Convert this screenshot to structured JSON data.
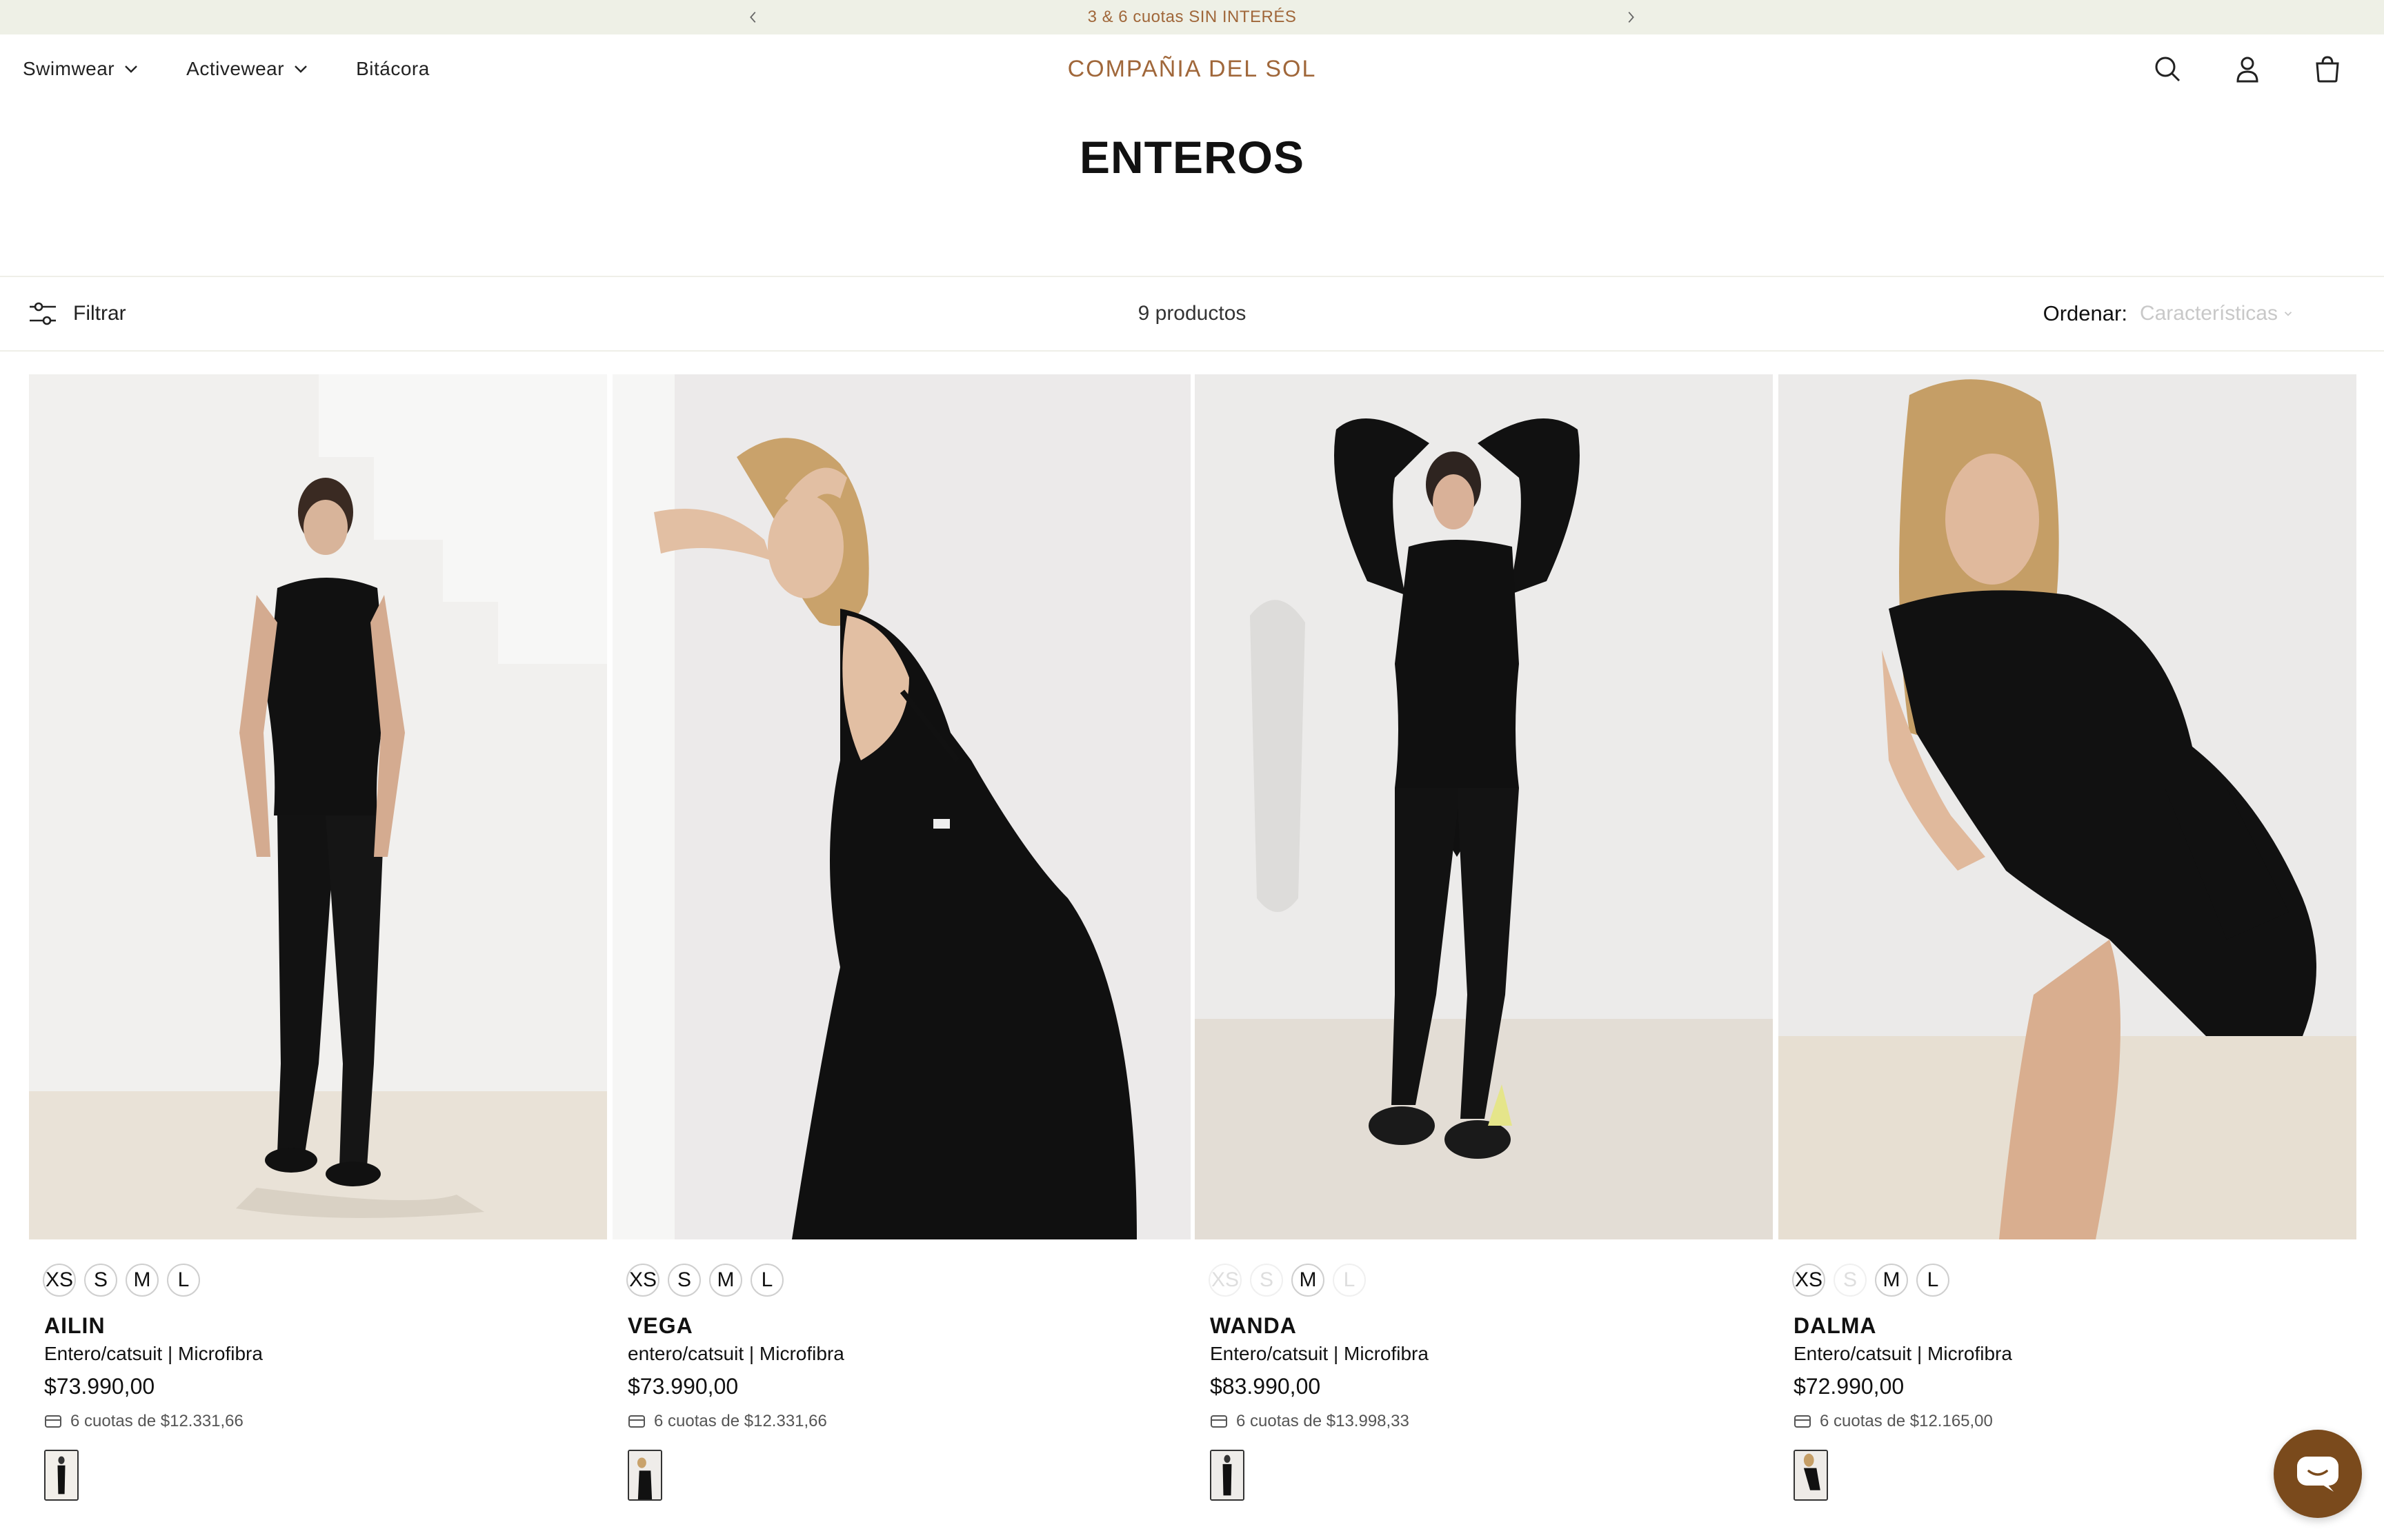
{
  "announcement": {
    "message": "3 & 6 cuotas SIN INTERÉS",
    "prev_icon": "chevron-left-icon",
    "next_icon": "chevron-right-icon"
  },
  "header": {
    "logo": "COMPAÑIA DEL SOL",
    "nav": [
      {
        "label": "Swimwear",
        "has_dropdown": true
      },
      {
        "label": "Activewear",
        "has_dropdown": true
      },
      {
        "label": "Bitácora",
        "has_dropdown": false
      }
    ],
    "icons": [
      "search-icon",
      "account-icon",
      "bag-icon"
    ]
  },
  "page": {
    "title": "ENTEROS"
  },
  "toolbar": {
    "filter_label": "Filtrar",
    "product_count": "9 productos",
    "sort_label": "Ordenar:",
    "sort_value": "Características"
  },
  "products": [
    {
      "name": "AILIN",
      "description": "Entero/catsuit | Microfibra",
      "price": "$73.990,00",
      "installments": "6 cuotas de $12.331,66",
      "sizes": [
        {
          "label": "XS",
          "available": true
        },
        {
          "label": "S",
          "available": true
        },
        {
          "label": "M",
          "available": true
        },
        {
          "label": "L",
          "available": true
        }
      ]
    },
    {
      "name": "VEGA",
      "description": "entero/catsuit | Microfibra",
      "price": "$73.990,00",
      "installments": "6 cuotas de $12.331,66",
      "sizes": [
        {
          "label": "XS",
          "available": true
        },
        {
          "label": "S",
          "available": true
        },
        {
          "label": "M",
          "available": true
        },
        {
          "label": "L",
          "available": true
        }
      ]
    },
    {
      "name": "WANDA",
      "description": "Entero/catsuit | Microfibra",
      "price": "$83.990,00",
      "installments": "6 cuotas de $13.998,33",
      "sizes": [
        {
          "label": "XS",
          "available": false
        },
        {
          "label": "S",
          "available": false
        },
        {
          "label": "M",
          "available": true
        },
        {
          "label": "L",
          "available": false
        }
      ]
    },
    {
      "name": "DALMA",
      "description": "Entero/catsuit | Microfibra",
      "price": "$72.990,00",
      "installments": "6 cuotas de $12.165,00",
      "sizes": [
        {
          "label": "XS",
          "available": true
        },
        {
          "label": "S",
          "available": false
        },
        {
          "label": "M",
          "available": true
        },
        {
          "label": "L",
          "available": true
        }
      ]
    }
  ],
  "colors": {
    "brand": "#a0673a",
    "announcement_bg": "#eef0e6",
    "chat_button": "#7a4a1c"
  },
  "chat": {
    "icon": "chat-bubble-icon"
  }
}
